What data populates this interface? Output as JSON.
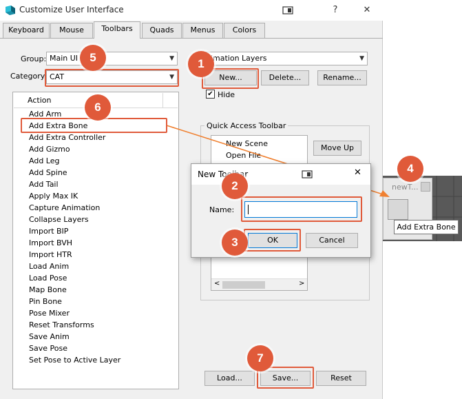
{
  "window": {
    "title": "Customize User Interface",
    "help_glyph": "?",
    "close_glyph": "✕"
  },
  "tabs": [
    {
      "label": "Keyboard"
    },
    {
      "label": "Mouse"
    },
    {
      "label": "Toolbars",
      "active": true
    },
    {
      "label": "Quads"
    },
    {
      "label": "Menus"
    },
    {
      "label": "Colors"
    }
  ],
  "group_field": {
    "label": "Group:",
    "value": "Main UI"
  },
  "category_field": {
    "label": "Category:",
    "value": "CAT"
  },
  "toolbar_select": {
    "value": "nimation Layers"
  },
  "buttons": {
    "new": "New...",
    "delete": "Delete...",
    "rename": "Rename...",
    "move_up": "Move Up",
    "load": "Load...",
    "save": "Save...",
    "reset": "Reset"
  },
  "hide_checkbox": {
    "label": "Hide",
    "checked": true,
    "mark": "✔"
  },
  "action_list": {
    "header": "Action",
    "items": [
      "Add Arm",
      "Add Extra Bone",
      "Add Extra Controller",
      "Add Gizmo",
      "Add Leg",
      "Add Spine",
      "Add Tail",
      "Apply Max IK",
      "Capture Animation",
      "Collapse Layers",
      "Import BIP",
      "Import BVH",
      "Import HTR",
      "Load Anim",
      "Load Pose",
      "Map Bone",
      "Pin Bone",
      "Pose Mixer",
      "Reset Transforms",
      "Save Anim",
      "Save Pose",
      "Set Pose to Active Layer"
    ]
  },
  "quick_access": {
    "title": "Quick Access Toolbar",
    "items": [
      "New Scene",
      "Open File"
    ],
    "scroll_left": "<",
    "scroll_right": ">"
  },
  "dialog": {
    "title": "New Toolbar",
    "close_glyph": "✕",
    "name_label": "Name:",
    "name_value": "",
    "ok": "OK",
    "cancel": "Cancel"
  },
  "floating_toolbar": {
    "title": "newT...",
    "tooltip": "Add Extra Bone"
  },
  "badges": [
    "1",
    "2",
    "3",
    "4",
    "5",
    "6",
    "7"
  ],
  "colors": {
    "highlight": "#e05a3a",
    "arrow": "#f08030"
  }
}
